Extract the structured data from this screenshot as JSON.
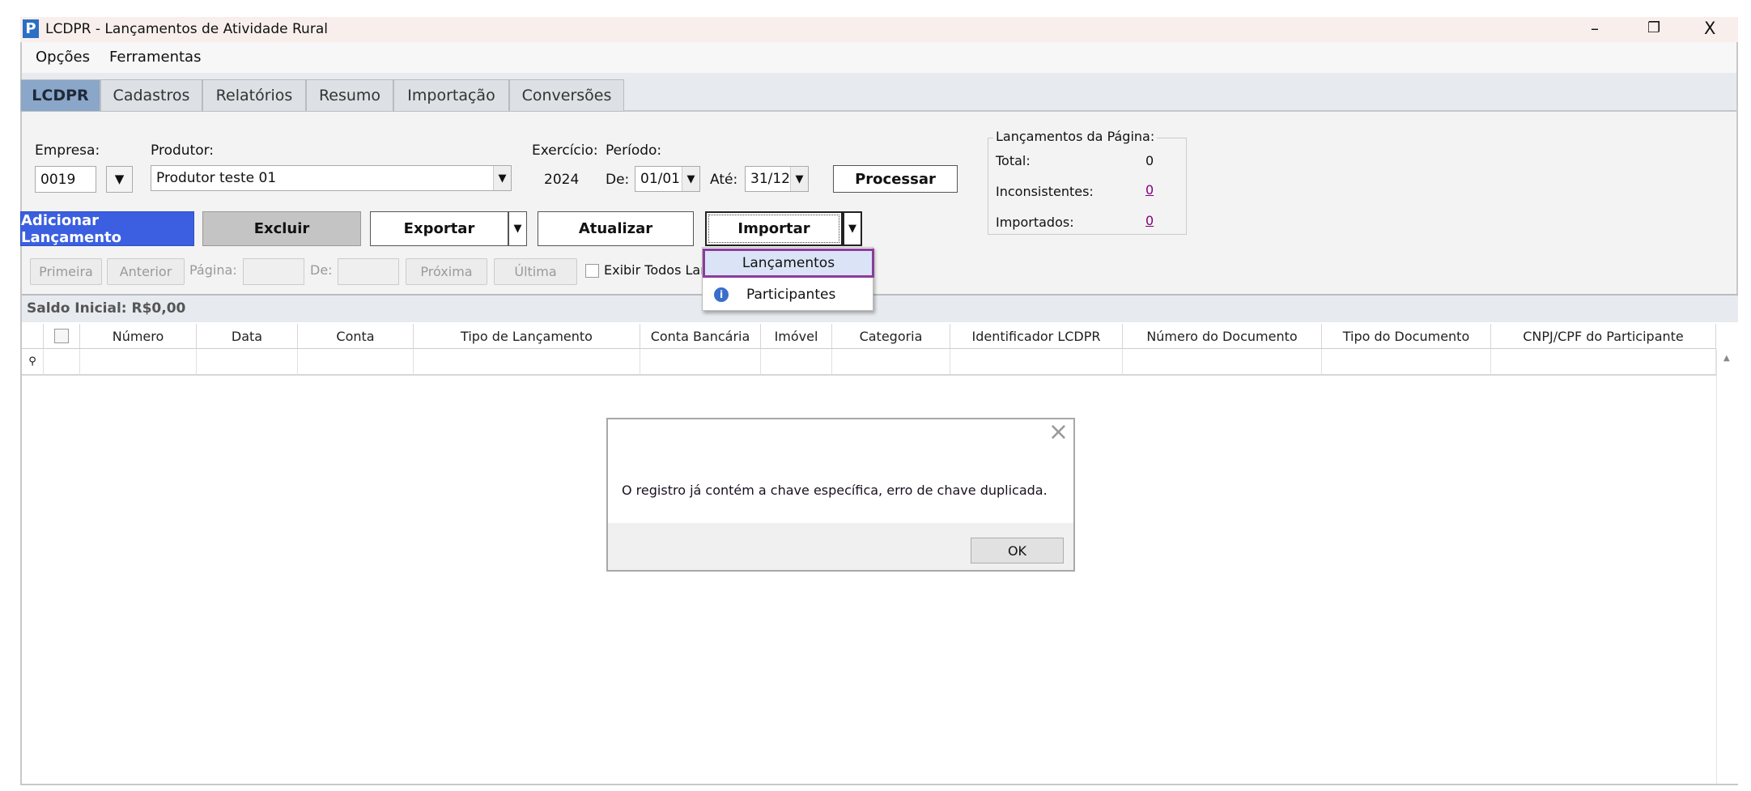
{
  "window": {
    "title": "LCDPR - Lançamentos de Atividade Rural",
    "app_icon": "P",
    "minimize": "–",
    "restore": "❐",
    "close": "X"
  },
  "menu": [
    "Opções",
    "Ferramentas"
  ],
  "tabs": [
    "LCDPR",
    "Cadastros",
    "Relatórios",
    "Resumo",
    "Importação",
    "Conversões"
  ],
  "filters": {
    "empresa_label": "Empresa:",
    "empresa_value": "0019",
    "produtor_label": "Produtor:",
    "produtor_value": "Produtor teste 01",
    "exercicio_label": "Exercício:",
    "exercicio_value": "2024",
    "periodo_label": "Período:",
    "de_label": "De:",
    "de_value": "01/01",
    "ate_label": "Até:",
    "ate_value": "31/12",
    "processar": "Processar"
  },
  "summary": {
    "title": "Lançamentos da Página:",
    "total_label": "Total:",
    "total_value": "0",
    "inconsistentes_label": "Inconsistentes:",
    "inconsistentes_value": "0",
    "importados_label": "Importados:",
    "importados_value": "0",
    "link_color": "#800080"
  },
  "toolbar": {
    "adicionar": "Adicionar Lançamento",
    "excluir": "Excluir",
    "exportar": "Exportar",
    "atualizar": "Atualizar",
    "importar": "Importar",
    "accent": "#3b5fe0"
  },
  "import_menu": [
    "Lançamentos",
    "Participantes"
  ],
  "pager": {
    "primeira": "Primeira",
    "anterior": "Anterior",
    "pagina_label": "Página:",
    "de_label": "De:",
    "proxima": "Próxima",
    "ultima": "Última",
    "exibir_todos": "Exibir Todos Lan"
  },
  "saldo": "Saldo Inicial: R$0,00",
  "grid": {
    "columns": [
      "Número",
      "Data",
      "Conta",
      "Tipo de Lançamento",
      "Conta Bancária",
      "Imóvel",
      "Categoria",
      "Identificador LCDPR",
      "Número do Documento",
      "Tipo do Documento",
      "CNPJ/CPF do Participante"
    ]
  },
  "dialog": {
    "message": "O registro já contém a chave específica, erro de chave duplicada.",
    "ok": "OK",
    "close": "×"
  }
}
